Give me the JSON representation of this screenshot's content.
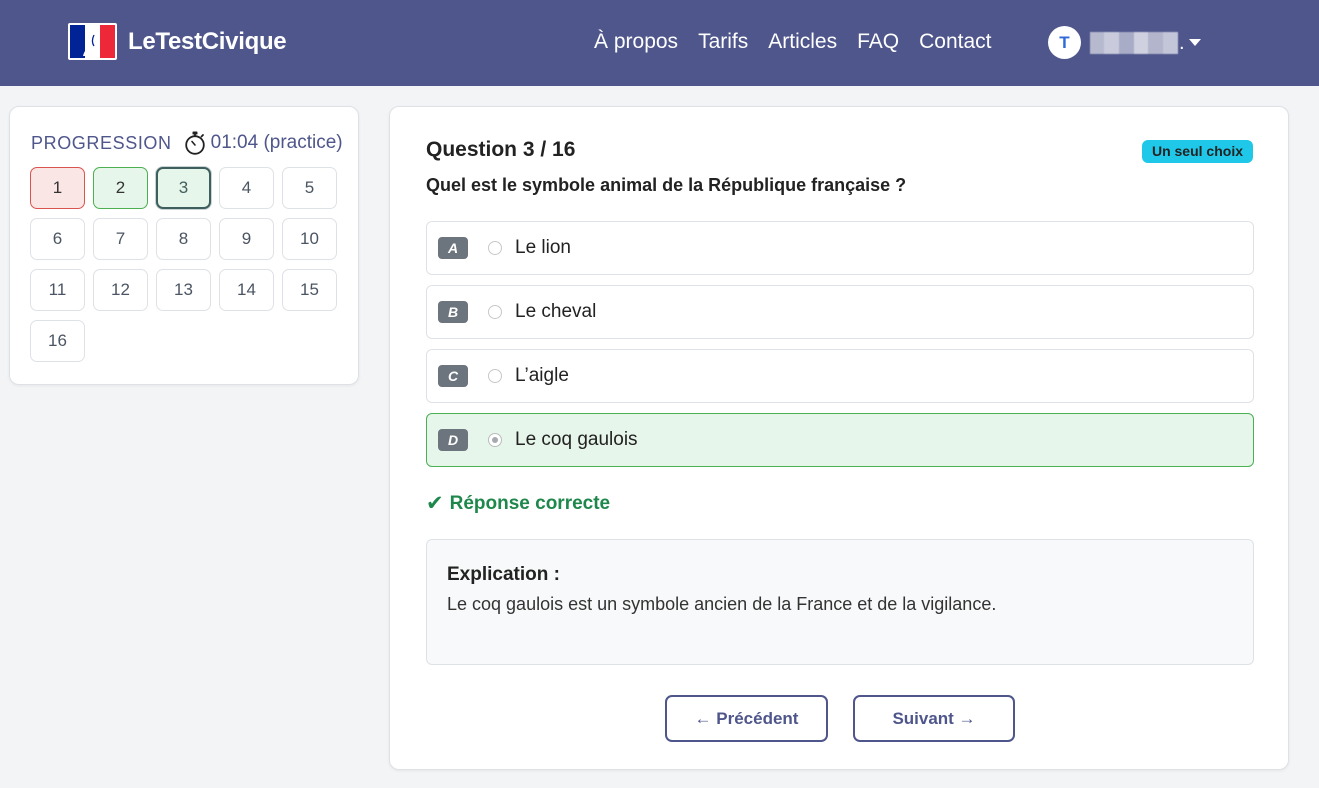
{
  "brand": {
    "name": "LeTestCivique",
    "logo_icon": "french-flag-marianne-logo"
  },
  "nav": {
    "links": [
      {
        "id": "about",
        "label": "À propos"
      },
      {
        "id": "pricing",
        "label": "Tarifs"
      },
      {
        "id": "articles",
        "label": "Articles"
      },
      {
        "id": "faq",
        "label": "FAQ"
      },
      {
        "id": "contact",
        "label": "Contact"
      }
    ],
    "user": {
      "initial": "T",
      "name_suffix": "."
    }
  },
  "sidebar": {
    "title": "PROGRESSION",
    "timer": "01:04 (practice)",
    "questions": [
      {
        "n": "1",
        "state": "wrong"
      },
      {
        "n": "2",
        "state": "right"
      },
      {
        "n": "3",
        "state": "current"
      },
      {
        "n": "4",
        "state": "unanswered"
      },
      {
        "n": "5",
        "state": "unanswered"
      },
      {
        "n": "6",
        "state": "unanswered"
      },
      {
        "n": "7",
        "state": "unanswered"
      },
      {
        "n": "8",
        "state": "unanswered"
      },
      {
        "n": "9",
        "state": "unanswered"
      },
      {
        "n": "10",
        "state": "unanswered"
      },
      {
        "n": "11",
        "state": "unanswered"
      },
      {
        "n": "12",
        "state": "unanswered"
      },
      {
        "n": "13",
        "state": "unanswered"
      },
      {
        "n": "14",
        "state": "unanswered"
      },
      {
        "n": "15",
        "state": "unanswered"
      },
      {
        "n": "16",
        "state": "unanswered"
      }
    ]
  },
  "question": {
    "number_label": "Question 3 / 16",
    "type_badge": "Un seul choix",
    "text": "Quel est le symbole animal de la République française ?",
    "options": [
      {
        "letter": "A",
        "label": "Le lion",
        "selected": false
      },
      {
        "letter": "B",
        "label": "Le cheval",
        "selected": false
      },
      {
        "letter": "C",
        "label": "L’aigle",
        "selected": false
      },
      {
        "letter": "D",
        "label": "Le coq gaulois",
        "selected": true
      }
    ],
    "feedback": {
      "icon": "✔",
      "text": "Réponse correcte"
    },
    "explanation": {
      "title": "Explication :",
      "text": "Le coq gaulois est un symbole ancien de la France et de la vigilance."
    }
  },
  "buttons": {
    "prev": "← Précédent",
    "next": "Suivant →"
  },
  "colors": {
    "navbar": "#4e568b",
    "correct": "#1e874b",
    "selected_bg": "#e7f6ea",
    "wrong_bg": "#fbe6e6",
    "badge": "#1fc8e8"
  }
}
